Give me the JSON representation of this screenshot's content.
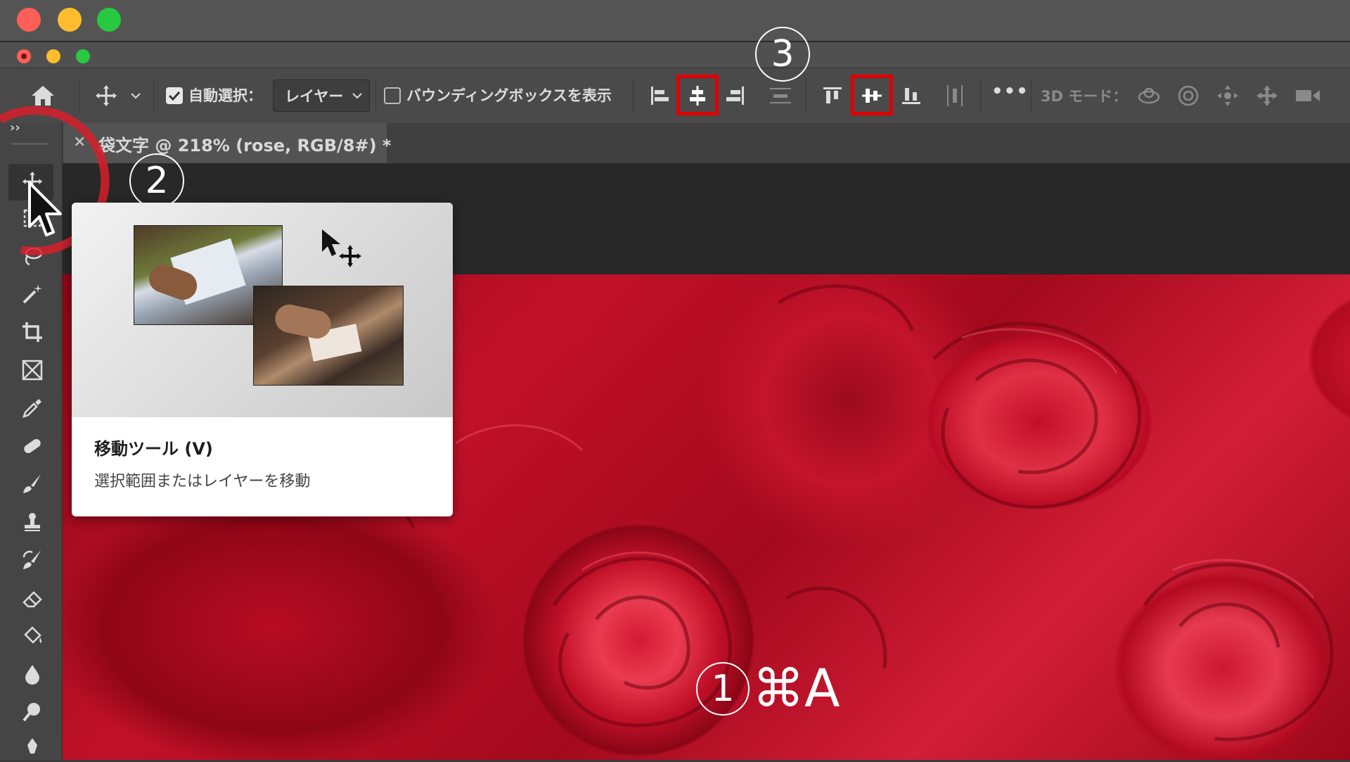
{
  "window": {
    "traffic_lights": [
      "close",
      "minimize",
      "zoom"
    ],
    "colors": {
      "close": "#ff5f57",
      "minimize": "#ffbd2e",
      "zoom": "#28c840"
    }
  },
  "options_bar": {
    "home_icon": "home-icon",
    "move_tool_icon": "move-icon",
    "auto_select_checked": true,
    "auto_select_label": "自動選択：",
    "auto_select_target": "レイヤー",
    "bounding_box_checked": false,
    "bounding_box_label": "バウンディングボックスを表示",
    "align_buttons": [
      "align-left-edges-icon",
      "align-horizontal-centers-icon",
      "align-right-edges-icon",
      "distribute-vertical-icon",
      "align-top-edges-icon",
      "align-vertical-centers-icon",
      "align-bottom-edges-icon",
      "distribute-horizontal-icon"
    ],
    "highlighted_buttons": [
      "align-horizontal-centers-icon",
      "align-vertical-centers-icon"
    ],
    "more_label": "•••",
    "mode_3d_label": "3D モード：",
    "mode_3d_icons": [
      "orbit-icon",
      "roll-icon",
      "pan-icon",
      "slide-icon",
      "scale-icon"
    ]
  },
  "document_tab": {
    "close_glyph": "×",
    "title": "袋文字 @ 218% (rose, RGB/8#) *"
  },
  "panel_toggle": "››",
  "tools": [
    "move-icon",
    "marquee-icon",
    "lasso-icon",
    "magic-wand-icon",
    "crop-icon",
    "frame-icon",
    "eyedropper-icon",
    "healing-icon",
    "brush-icon",
    "stamp-icon",
    "history-brush-icon",
    "eraser-icon",
    "paint-bucket-icon",
    "blur-icon",
    "dodge-icon"
  ],
  "tooltip": {
    "title": "移動ツール (V)",
    "description": "選択範囲またはレイヤーを移動"
  },
  "annotations": {
    "step1_number": "1",
    "step1_shortcut": "⌘A",
    "step2_number": "2",
    "step3_number": "3",
    "accent_red": "#e00000"
  }
}
